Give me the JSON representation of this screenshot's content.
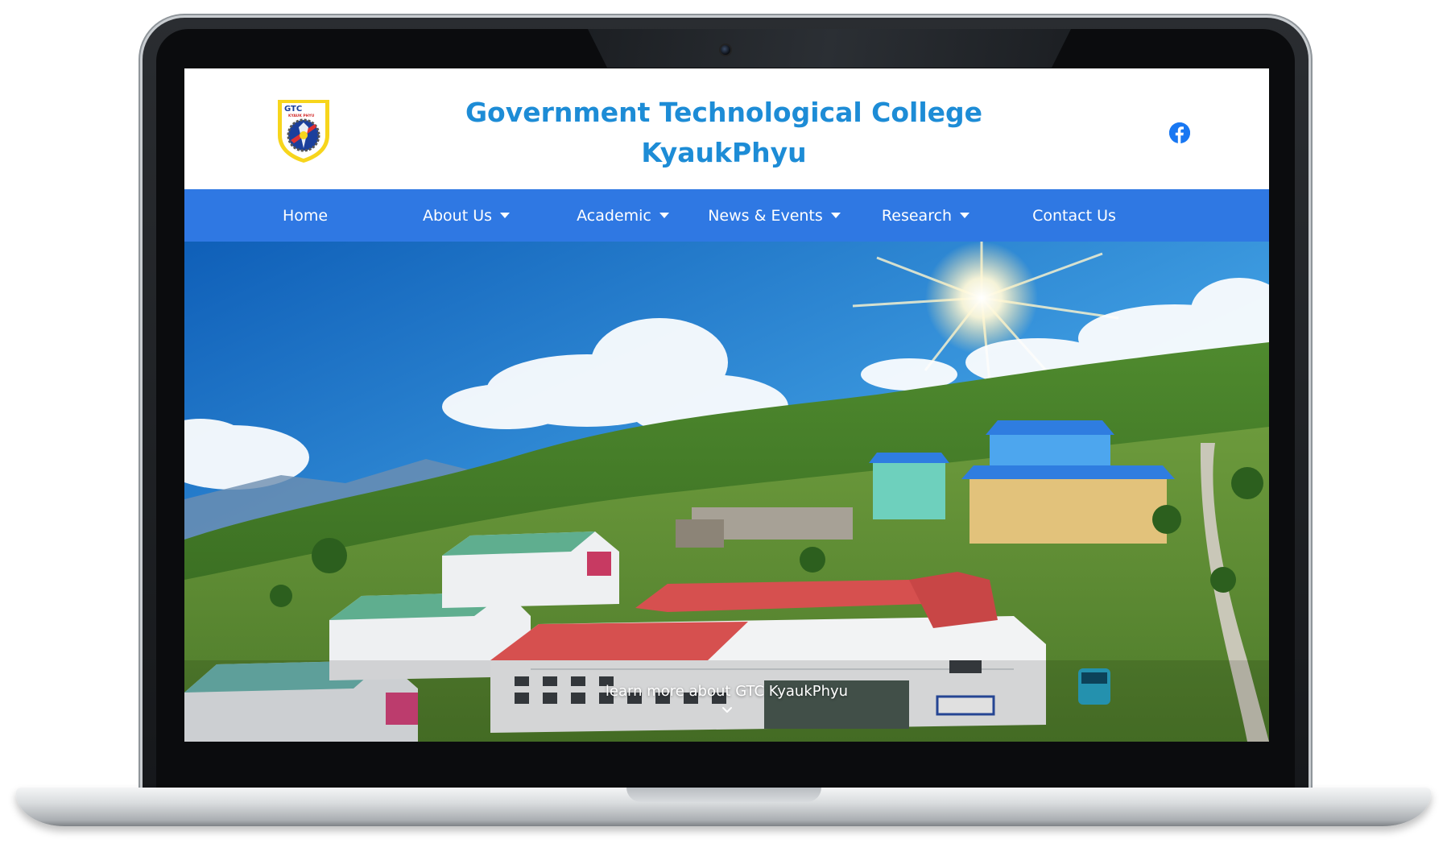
{
  "header": {
    "title_line1": "Government Technological College",
    "title_line2": "KyaukPhyu",
    "logo_text": "GTC",
    "logo_subtext": "KYAUK PHYU",
    "social_icon": "facebook-icon"
  },
  "nav": {
    "items": [
      {
        "label": "Home",
        "has_dropdown": false
      },
      {
        "label": "About Us",
        "has_dropdown": true
      },
      {
        "label": "Academic",
        "has_dropdown": true
      },
      {
        "label": "News & Events",
        "has_dropdown": true
      },
      {
        "label": "Research",
        "has_dropdown": true
      },
      {
        "label": "Contact Us",
        "has_dropdown": false
      }
    ]
  },
  "hero": {
    "link_text": "learn more about GTC KyaukPhyu",
    "icon": "chevron-down-icon"
  },
  "colors": {
    "title": "#1d8cd6",
    "nav_bg": "#2f78e3",
    "facebook": "#1877f2"
  }
}
